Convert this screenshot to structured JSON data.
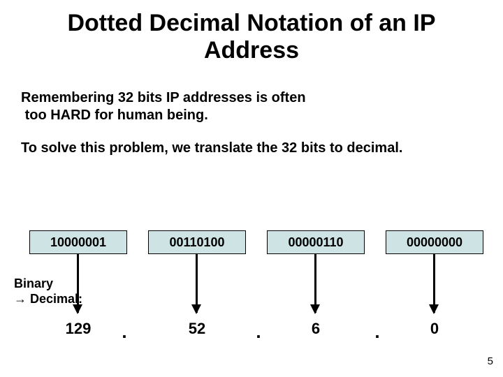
{
  "title": "Dotted Decimal Notation of an IP Address",
  "paragraph1_line1": "Remembering 32 bits IP addresses is often",
  "paragraph1_line2": "too HARD for human being.",
  "paragraph2": "To solve this problem, we translate the 32 bits to decimal.",
  "octets": {
    "o1": "10000001",
    "o2": "00110100",
    "o3": "00000110",
    "o4": "00000000"
  },
  "conversion_label_line1": "Binary",
  "conversion_label_line2": "Decimal:",
  "decimals": {
    "d1": "129",
    "d2": "52",
    "d3": "6",
    "d4": "0"
  },
  "dot": ".",
  "arrow_glyph": "→",
  "slide_number": "5"
}
